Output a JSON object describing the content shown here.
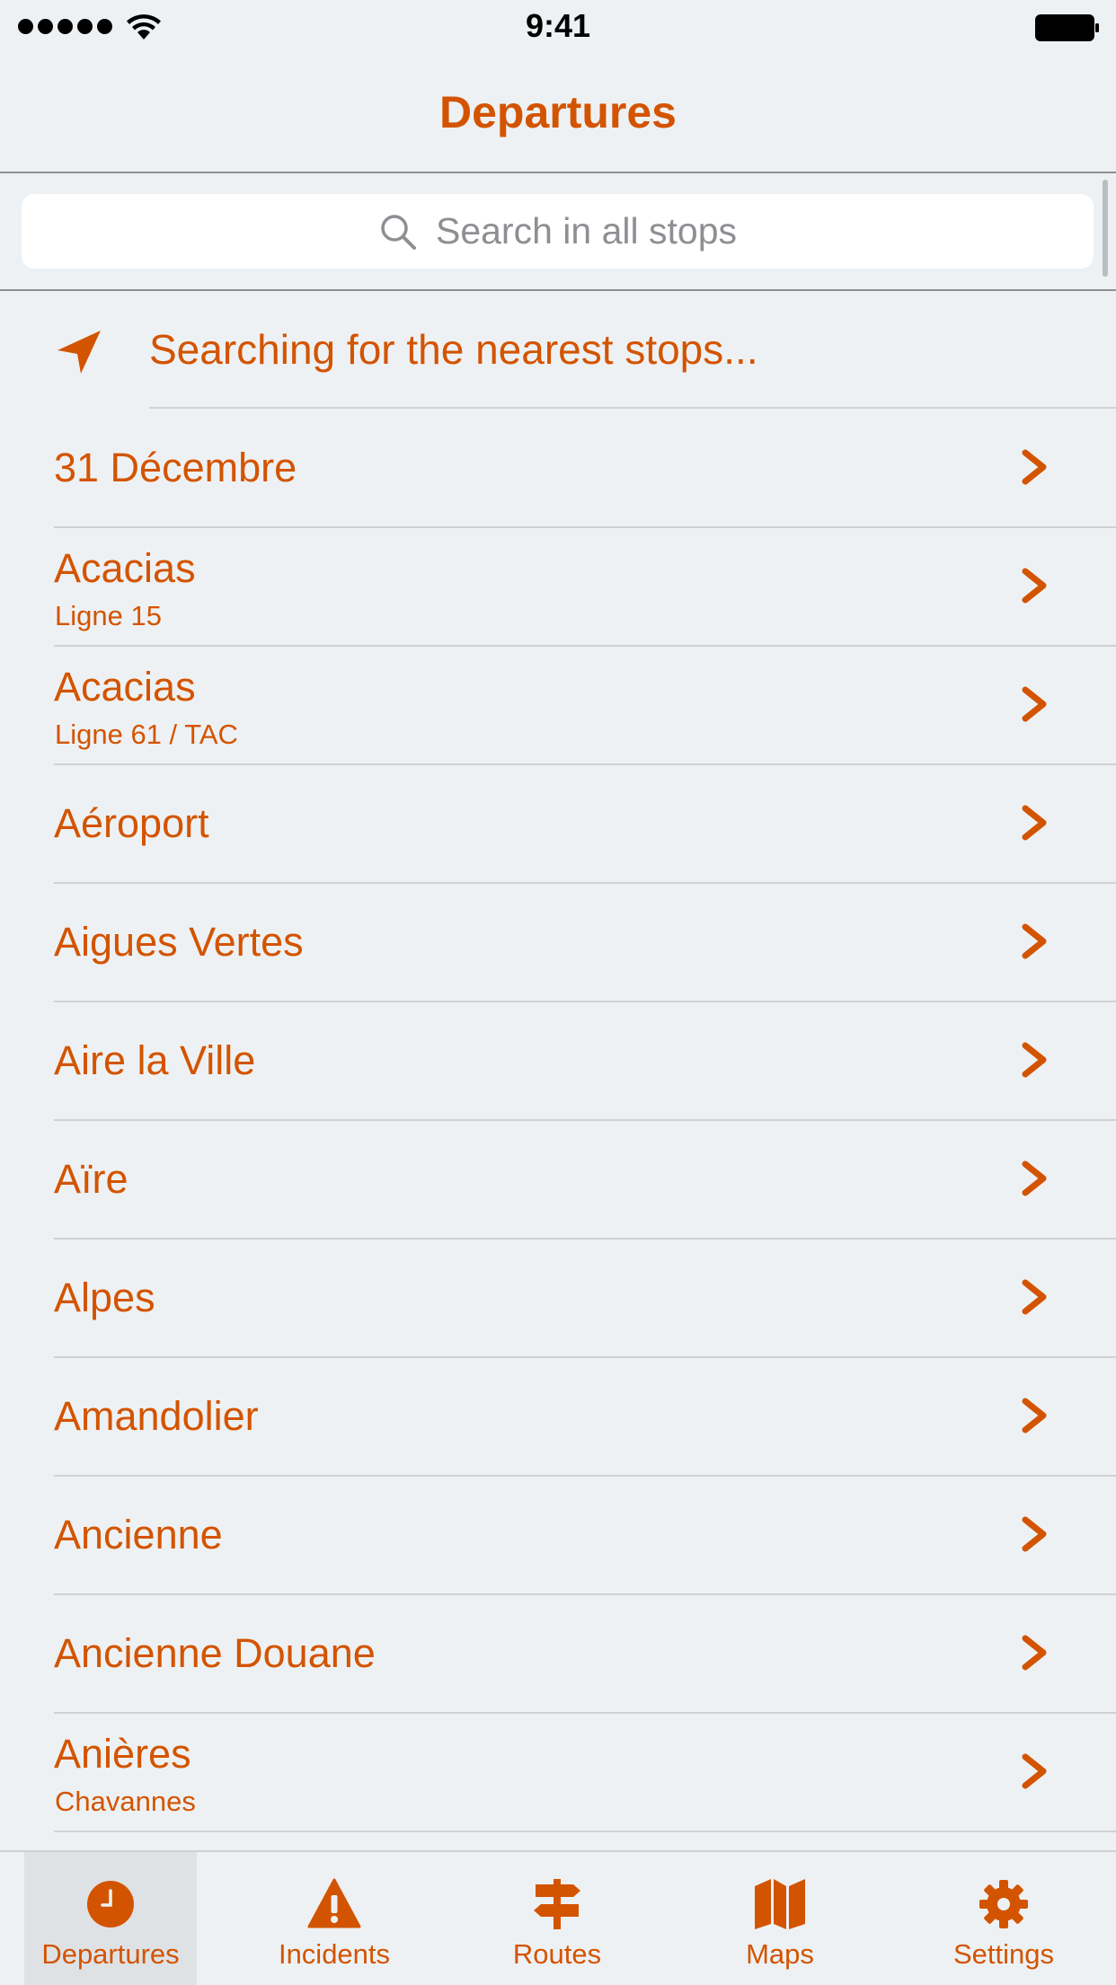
{
  "status_bar": {
    "time": "9:41"
  },
  "nav": {
    "title": "Departures"
  },
  "search": {
    "placeholder": "Search in all stops"
  },
  "nearest": {
    "label": "Searching for the nearest stops..."
  },
  "stops": [
    {
      "name": "31 Décembre",
      "sub": ""
    },
    {
      "name": "Acacias",
      "sub": "Ligne 15"
    },
    {
      "name": "Acacias",
      "sub": "Ligne 61 / TAC"
    },
    {
      "name": "Aéroport",
      "sub": ""
    },
    {
      "name": "Aigues Vertes",
      "sub": ""
    },
    {
      "name": "Aire la Ville",
      "sub": ""
    },
    {
      "name": "Aïre",
      "sub": ""
    },
    {
      "name": "Alpes",
      "sub": ""
    },
    {
      "name": "Amandolier",
      "sub": ""
    },
    {
      "name": "Ancienne",
      "sub": ""
    },
    {
      "name": "Ancienne Douane",
      "sub": ""
    },
    {
      "name": "Anières",
      "sub": "Chavannes"
    }
  ],
  "tabs": [
    {
      "label": "Departures",
      "icon": "clock-icon",
      "selected": true
    },
    {
      "label": "Incidents",
      "icon": "warning-icon",
      "selected": false
    },
    {
      "label": "Routes",
      "icon": "signpost-icon",
      "selected": false
    },
    {
      "label": "Maps",
      "icon": "map-icon",
      "selected": false
    },
    {
      "label": "Settings",
      "icon": "gear-icon",
      "selected": false
    }
  ],
  "colors": {
    "accent": "#d35400",
    "background": "#eef1f3",
    "separator": "#cfd1d4",
    "placeholder": "#8e8e93"
  }
}
